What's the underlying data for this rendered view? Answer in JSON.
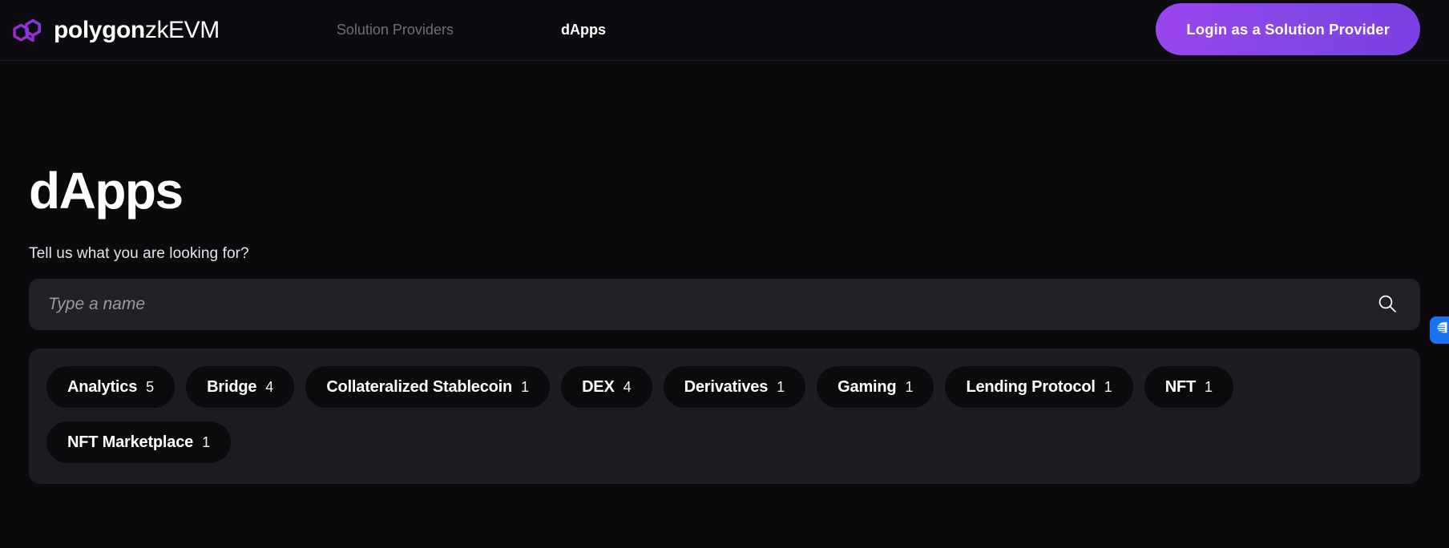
{
  "header": {
    "logo": {
      "brand_bold": "polygon",
      "brand_light": "zkEVM",
      "mark_icon": "polygon-logo-icon",
      "mark_color_start": "#a726c1",
      "mark_color_end": "#803bdf"
    },
    "nav": [
      {
        "label": "Solution Providers",
        "active": false
      },
      {
        "label": "dApps",
        "active": true
      }
    ],
    "login_button": {
      "label": "Login as a Solution Provider",
      "color": "#8247e5"
    }
  },
  "main": {
    "title": "dApps",
    "subtitle": "Tell us what you are looking for?",
    "search": {
      "value": "",
      "placeholder": "Type a name",
      "icon": "search-icon"
    },
    "categories": [
      {
        "label": "Analytics",
        "count": "5"
      },
      {
        "label": "Bridge",
        "count": "4"
      },
      {
        "label": "Collateralized Stablecoin",
        "count": "1"
      },
      {
        "label": "DEX",
        "count": "4"
      },
      {
        "label": "Derivatives",
        "count": "1"
      },
      {
        "label": "Gaming",
        "count": "1"
      },
      {
        "label": "Lending Protocol",
        "count": "1"
      },
      {
        "label": "NFT",
        "count": "1"
      },
      {
        "label": "NFT Marketplace",
        "count": "1"
      }
    ]
  },
  "edge_widget": {
    "icon": "brain-icon",
    "color": "#1a73f0"
  }
}
